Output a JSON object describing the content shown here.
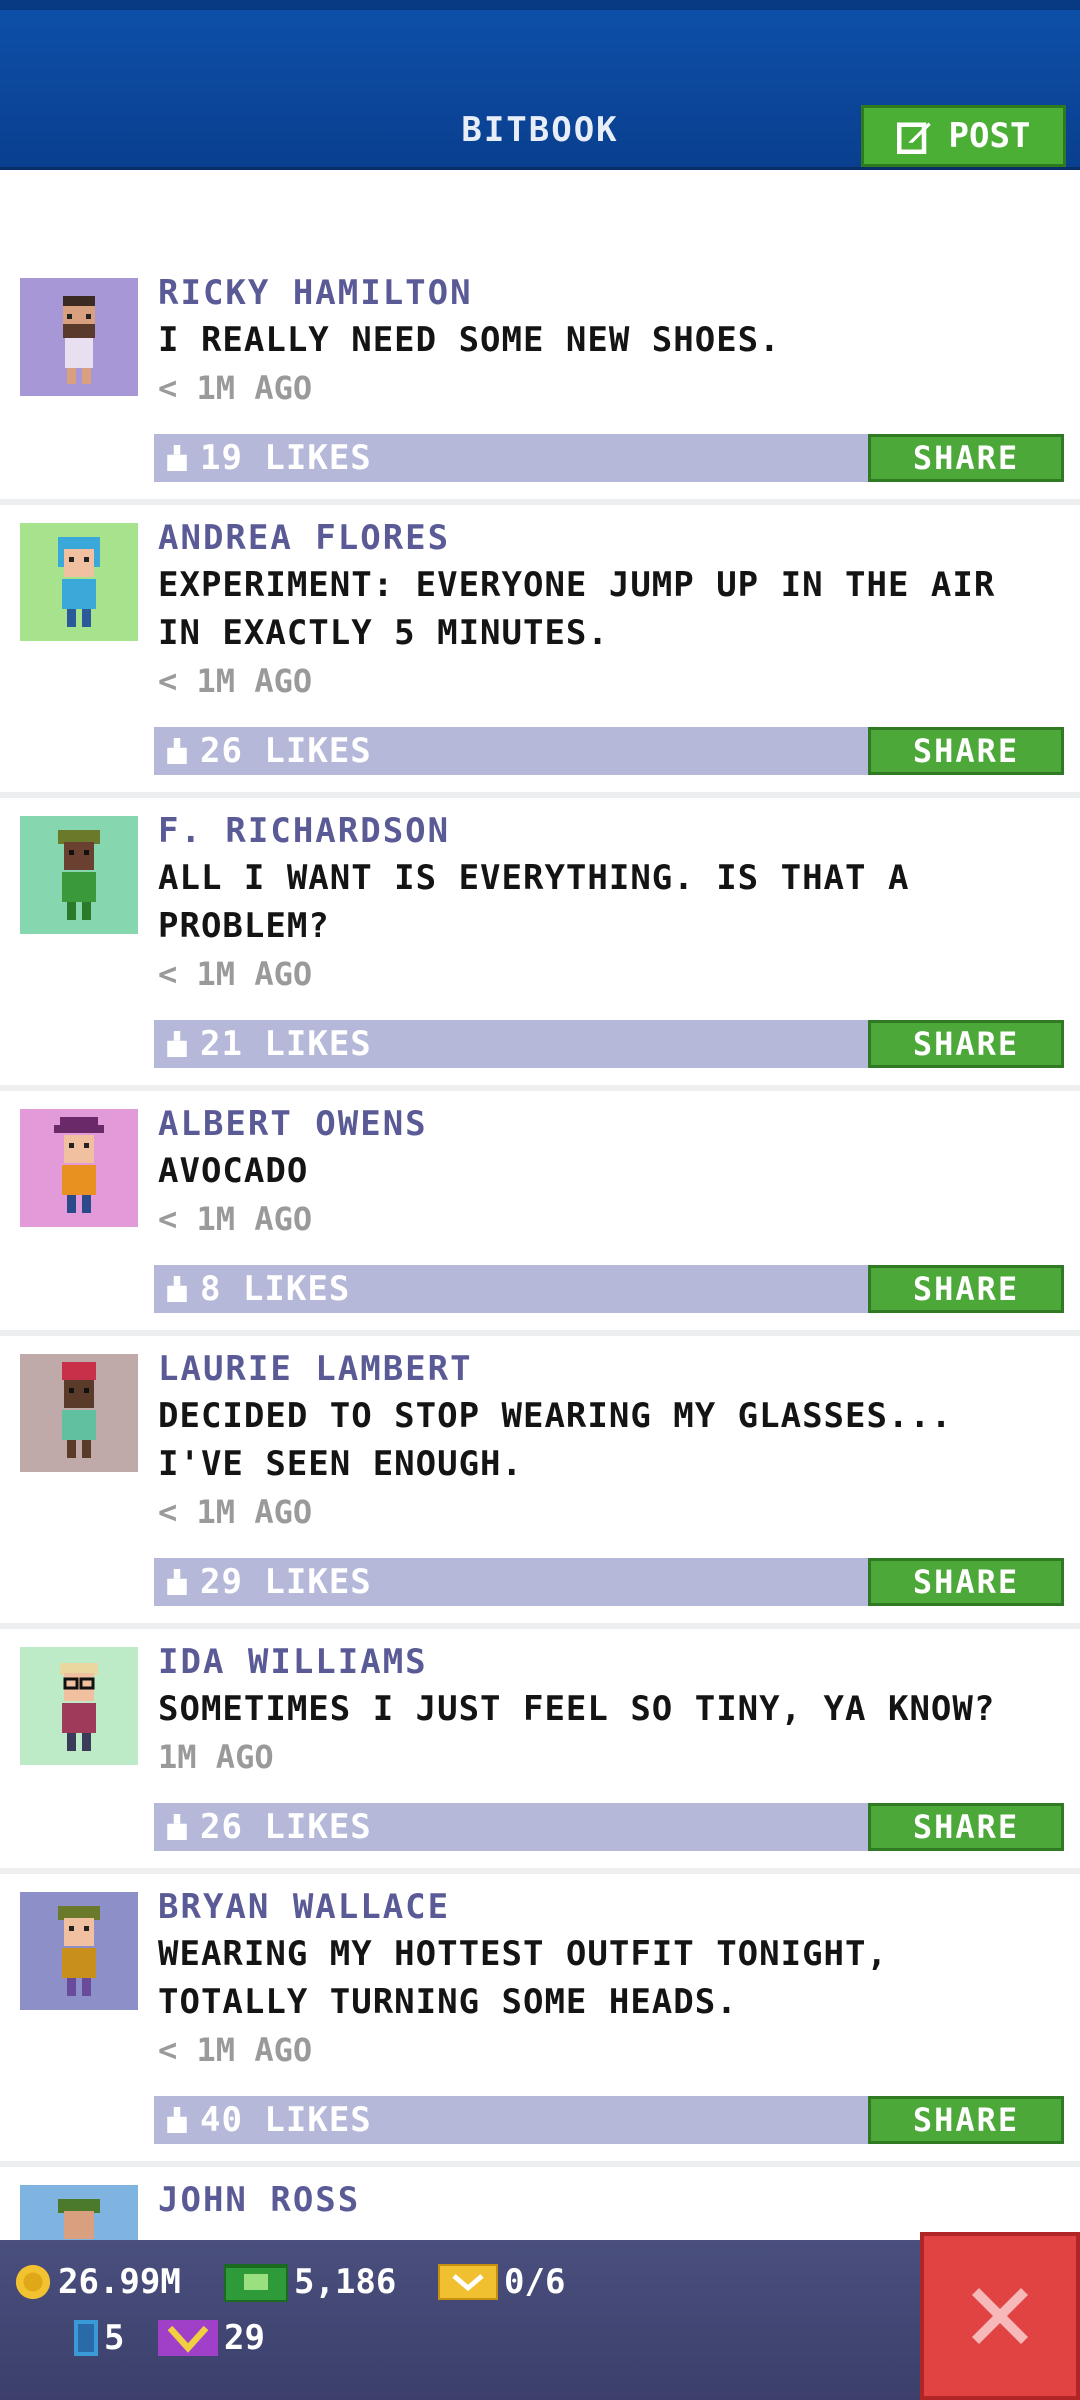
{
  "header": {
    "title": "BITBOOK",
    "post_label": "POST"
  },
  "posts": [
    {
      "name": "RICKY HAMILTON",
      "lines": [
        "I REALLY NEED SOME NEW SHOES."
      ],
      "time": "< 1M AGO",
      "likes": "19 LIKES",
      "share": "SHARE",
      "avatar_bg": "#a797d6"
    },
    {
      "name": "ANDREA FLORES",
      "lines": [
        "EXPERIMENT: EVERYONE JUMP UP IN THE AIR",
        "IN EXACTLY 5 MINUTES."
      ],
      "time": "< 1M AGO",
      "likes": "26 LIKES",
      "share": "SHARE",
      "avatar_bg": "#a6e38c"
    },
    {
      "name": "F. RICHARDSON",
      "lines": [
        "ALL I WANT IS EVERYTHING. IS THAT A",
        "PROBLEM?"
      ],
      "time": "< 1M AGO",
      "likes": "21 LIKES",
      "share": "SHARE",
      "avatar_bg": "#86d6b0"
    },
    {
      "name": "ALBERT OWENS",
      "lines": [
        "AVOCADO"
      ],
      "time": "< 1M AGO",
      "likes": "8 LIKES",
      "share": "SHARE",
      "avatar_bg": "#e39ad9"
    },
    {
      "name": "LAURIE LAMBERT",
      "lines": [
        "DECIDED TO STOP WEARING MY GLASSES...",
        "I'VE SEEN ENOUGH."
      ],
      "time": "< 1M AGO",
      "likes": "29 LIKES",
      "share": "SHARE",
      "avatar_bg": "#bfa9a9"
    },
    {
      "name": "IDA WILLIAMS",
      "lines": [
        "SOMETIMES I JUST FEEL SO TINY, YA KNOW?"
      ],
      "time": "1M AGO",
      "likes": "26 LIKES",
      "share": "SHARE",
      "avatar_bg": "#bdebc8"
    },
    {
      "name": "BRYAN WALLACE",
      "lines": [
        "WEARING MY HOTTEST OUTFIT TONIGHT,",
        "TOTALLY TURNING SOME HEADS."
      ],
      "time": "< 1M AGO",
      "likes": "40 LIKES",
      "share": "SHARE",
      "avatar_bg": "#8d8fc9"
    },
    {
      "name": "JOHN ROSS",
      "lines": [],
      "time": "",
      "likes": "",
      "share": "",
      "avatar_bg": "#7fb3e0"
    }
  ],
  "status": {
    "coins": "26.99M",
    "bux": "5,186",
    "tickets": "0/6",
    "elevator": "5",
    "bitizens": "29"
  },
  "colors": {
    "header_blue": "#0d4fa8",
    "share_green": "#4ca838",
    "like_bar": "#b5b8d8",
    "name_purple": "#5a5a96"
  }
}
